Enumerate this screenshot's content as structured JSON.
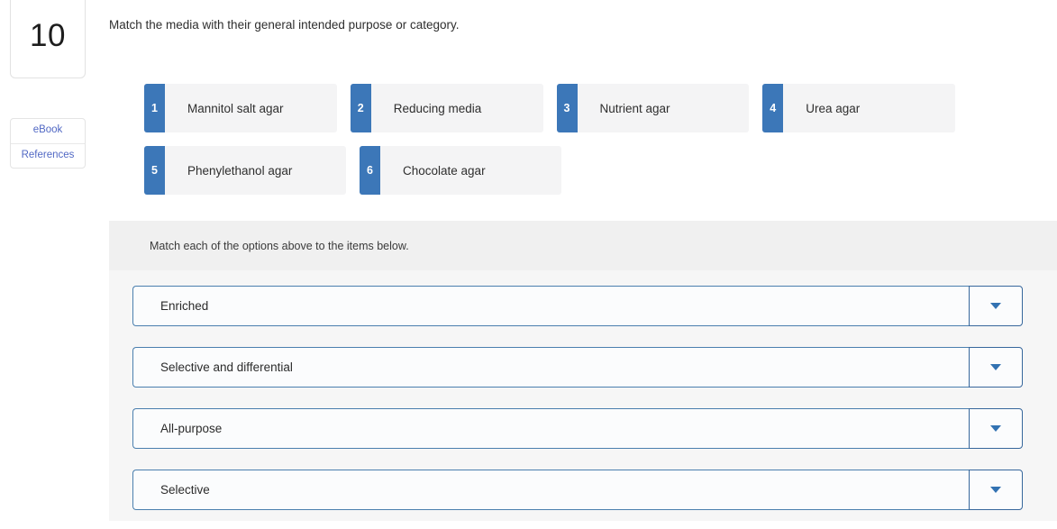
{
  "rail": {
    "question_number": "10",
    "links": [
      {
        "label": "eBook",
        "name": "ebook-link"
      },
      {
        "label": "References",
        "name": "references-link"
      }
    ]
  },
  "prompt": "Match the media with their general intended purpose or category.",
  "options": [
    {
      "number": "1",
      "label": "Mannitol salt agar"
    },
    {
      "number": "2",
      "label": "Reducing media"
    },
    {
      "number": "3",
      "label": "Nutrient agar"
    },
    {
      "number": "4",
      "label": "Urea agar"
    },
    {
      "number": "5",
      "label": "Phenylethanol agar"
    },
    {
      "number": "6",
      "label": "Chocolate agar"
    }
  ],
  "answer_panel": {
    "hint": "Match each of the options above to the items below.",
    "rows": [
      {
        "label": "Enriched",
        "caret_icon": "caret-down-icon"
      },
      {
        "label": "Selective and differential",
        "caret_icon": "caret-down-icon"
      },
      {
        "label": "All-purpose",
        "caret_icon": "caret-down-icon"
      },
      {
        "label": "Selective",
        "caret_icon": "caret-down-icon"
      }
    ]
  },
  "colors": {
    "badge_blue": "#3c77b8",
    "link_blue": "#5168c4",
    "select_border": "#4a7fae",
    "caret_blue": "#3272b2",
    "tile_gray": "#f4f4f5",
    "panel_gray": "#f6f6f6",
    "panel_header_gray": "#f0f0f0"
  }
}
